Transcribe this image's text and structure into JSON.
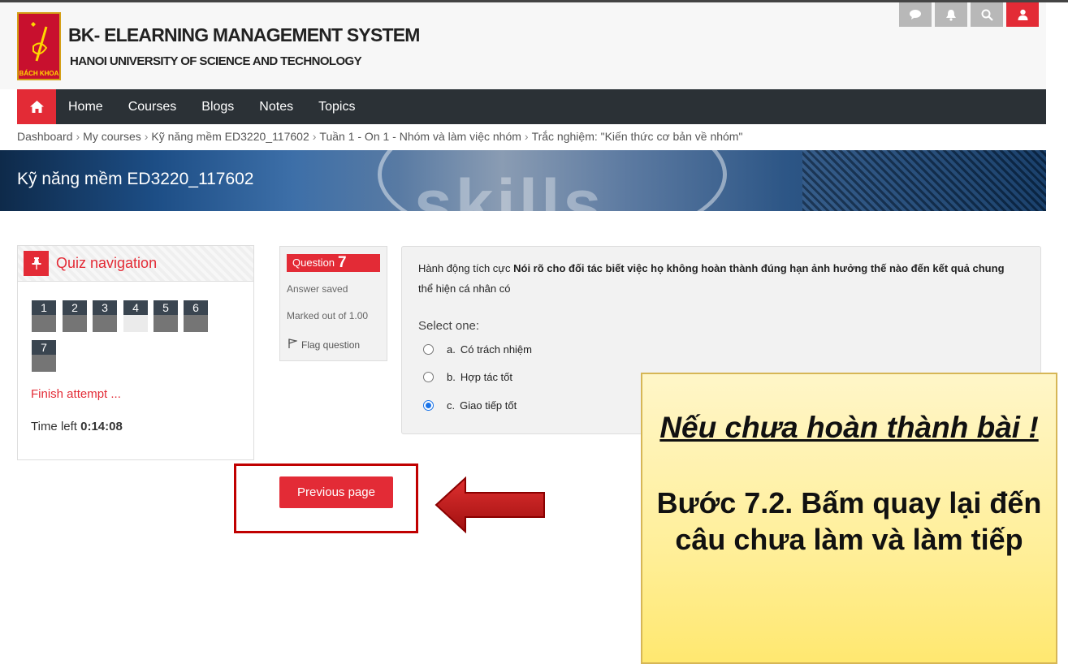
{
  "header": {
    "logo_text": "BÁCH KHOA",
    "title": "BK- ELEARNING MANAGEMENT SYSTEM",
    "subtitle": "HANOI UNIVERSITY OF SCIENCE AND TECHNOLOGY",
    "icons": [
      "chat-icon",
      "bell-icon",
      "search-icon",
      "user-icon"
    ]
  },
  "nav": {
    "items": [
      "Home",
      "Courses",
      "Blogs",
      "Notes",
      "Topics"
    ]
  },
  "breadcrumb": [
    "Dashboard",
    "My courses",
    "Kỹ năng mềm ED3220_117602",
    "Tuần 1 - On 1 - Nhóm và làm việc nhóm",
    "Trắc nghiệm: \"Kiến thức cơ bản về nhóm\""
  ],
  "banner": {
    "course_title": "Kỹ năng mềm ED3220_117602",
    "art_text": "skills"
  },
  "quiz_nav": {
    "title": "Quiz navigation",
    "questions": [
      {
        "num": "1",
        "answered": true
      },
      {
        "num": "2",
        "answered": true
      },
      {
        "num": "3",
        "answered": true
      },
      {
        "num": "4",
        "answered": false
      },
      {
        "num": "5",
        "answered": true
      },
      {
        "num": "6",
        "answered": true
      },
      {
        "num": "7",
        "answered": true
      }
    ],
    "finish": "Finish attempt ...",
    "time_label": "Time left",
    "time_value": "0:14:08"
  },
  "question_info": {
    "label": "Question",
    "number": "7",
    "status": "Answer saved",
    "marks": "Marked out of 1.00",
    "flag": "Flag question"
  },
  "question": {
    "prefix": "Hành động tích cực",
    "bold": "Nói rõ cho đối tác biết việc họ không hoàn thành đúng hạn ảnh hưởng thế nào đến kết quả chung",
    "suffix": "thể hiện cá nhân có",
    "select_one": "Select one:",
    "options": [
      {
        "letter": "a.",
        "text": "Có trách nhiệm",
        "selected": false
      },
      {
        "letter": "b.",
        "text": "Hợp tác tốt",
        "selected": false
      },
      {
        "letter": "c.",
        "text": "Giao tiếp tốt",
        "selected": true
      }
    ]
  },
  "buttons": {
    "previous_page": "Previous page"
  },
  "annotation": {
    "line1": "Nếu chưa hoàn thành bài !",
    "line2": "Bước 7.2. Bấm quay lại đến câu chưa làm và làm tiếp"
  },
  "colors": {
    "accent_red": "#e32b36",
    "nav_dark": "#2b3136",
    "note_yellow": "#ffef9a"
  }
}
